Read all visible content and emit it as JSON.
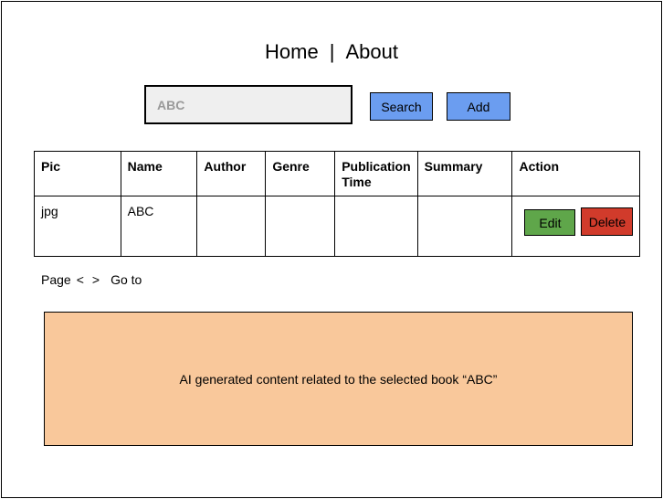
{
  "nav": {
    "home": "Home",
    "separator": "|",
    "about": "About"
  },
  "search": {
    "value": "ABC",
    "search_label": "Search",
    "add_label": "Add"
  },
  "table": {
    "headers": {
      "pic": "Pic",
      "name": "Name",
      "author": "Author",
      "genre": "Genre",
      "publication_time": "Publication Time",
      "summary": "Summary",
      "action": "Action"
    },
    "rows": [
      {
        "pic": "jpg",
        "name": "ABC",
        "author": "",
        "genre": "",
        "publication_time": "",
        "summary": "",
        "edit_label": "Edit",
        "delete_label": "Delete"
      }
    ]
  },
  "pager": {
    "page_label": "Page",
    "prev": "<",
    "next": ">",
    "goto": "Go to"
  },
  "ai_panel": {
    "text": "AI generated content related to the selected book “ABC”"
  },
  "colors": {
    "primary_button": "#6b9df0",
    "edit_button": "#5fa64a",
    "delete_button": "#d13b2b",
    "ai_panel_bg": "#f9c89b",
    "input_bg": "#efefef"
  }
}
